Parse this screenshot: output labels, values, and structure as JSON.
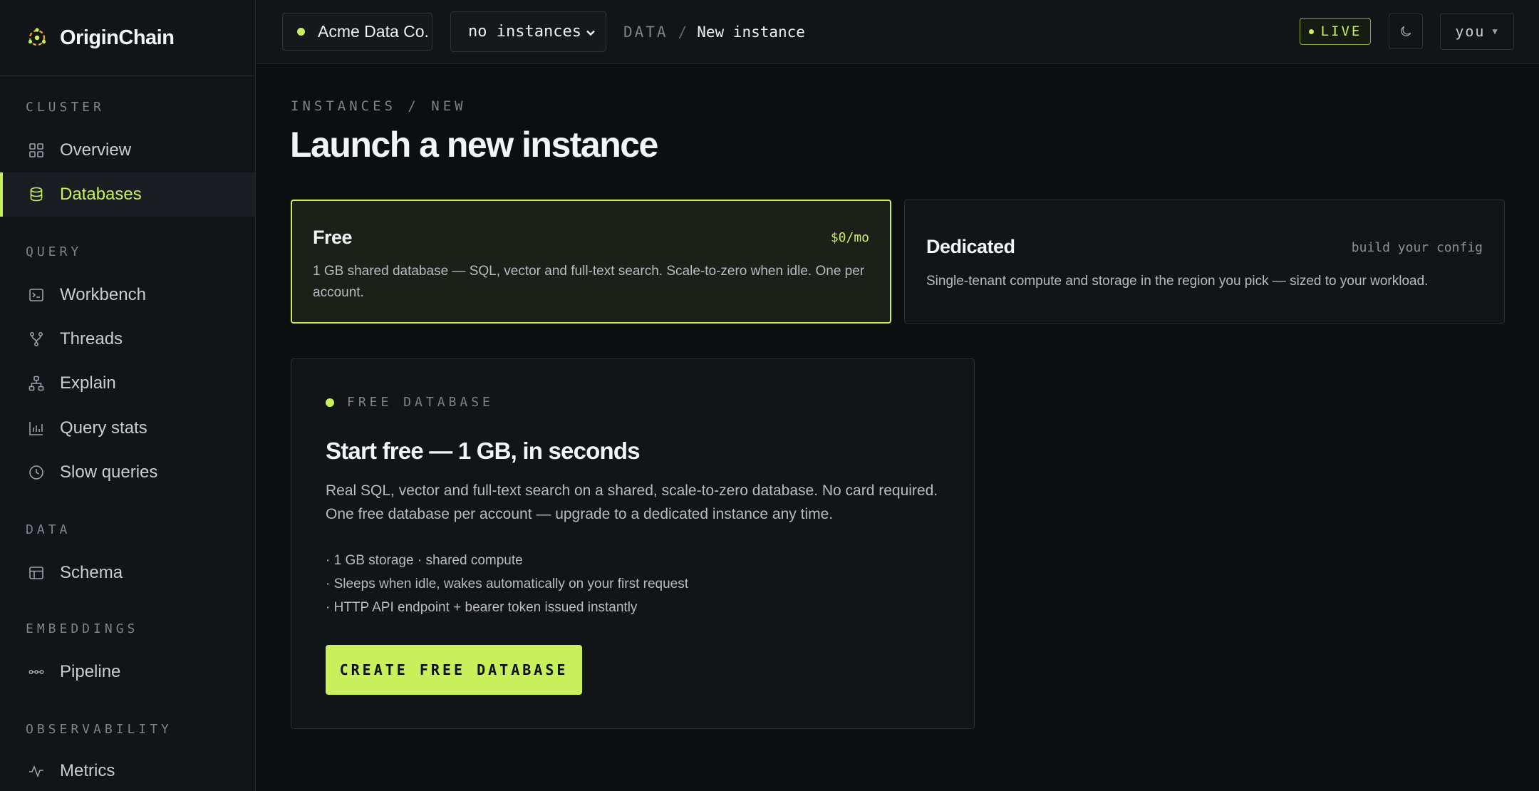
{
  "brand": {
    "name": "OriginChain",
    "logo_icon": "origin-logo-icon"
  },
  "sidebar": {
    "sections": [
      {
        "label": "CLUSTER"
      },
      {
        "label": "QUERY"
      },
      {
        "label": "DATA"
      },
      {
        "label": "EMBEDDINGS"
      },
      {
        "label": "OBSERVABILITY"
      }
    ],
    "items": [
      {
        "label": "Overview",
        "icon": "grid-icon",
        "active": false
      },
      {
        "label": "Databases",
        "icon": "database-icon",
        "active": true
      },
      {
        "label": "Workbench",
        "icon": "terminal-icon",
        "active": false
      },
      {
        "label": "Threads",
        "icon": "branch-icon",
        "active": false
      },
      {
        "label": "Explain",
        "icon": "tree-icon",
        "active": false
      },
      {
        "label": "Query stats",
        "icon": "bar-chart-icon",
        "active": false
      },
      {
        "label": "Slow queries",
        "icon": "clock-icon",
        "active": false
      },
      {
        "label": "Schema",
        "icon": "table-icon",
        "active": false
      },
      {
        "label": "Pipeline",
        "icon": "pipeline-icon",
        "active": false
      },
      {
        "label": "Metrics",
        "icon": "pulse-icon",
        "active": false
      }
    ]
  },
  "topbar": {
    "org": "Acme Data Co.",
    "instance_select": "no instances",
    "breadcrumb": {
      "section": "DATA",
      "separator": "/",
      "page": "New instance"
    },
    "live_badge": "LIVE",
    "user": "you"
  },
  "main": {
    "eyebrow": "INSTANCES / NEW",
    "title": "Launch a new instance",
    "plans": [
      {
        "name": "Free",
        "price": "$0/mo",
        "description": "1 GB shared database — SQL, vector and full-text search. Scale-to-zero when idle. One per account.",
        "selected": true
      },
      {
        "name": "Dedicated",
        "price": "build your config",
        "description": "Single-tenant compute and storage in the region you pick — sized to your workload.",
        "selected": false
      }
    ],
    "panel": {
      "eyebrow": "FREE DATABASE",
      "title": "Start free — 1 GB, in seconds",
      "description": "Real SQL, vector and full-text search on a shared, scale-to-zero database. No card required. One free database per account — upgrade to a dedicated instance any time.",
      "bullets": [
        "· 1 GB storage · shared compute",
        "· Sleeps when idle, wakes automatically on your first request",
        "· HTTP API endpoint + bearer token issued instantly"
      ],
      "cta": "CREATE FREE DATABASE"
    }
  },
  "colors": {
    "accent": "#c8f05a",
    "background": "#0c0e10",
    "panel": "#121518"
  }
}
